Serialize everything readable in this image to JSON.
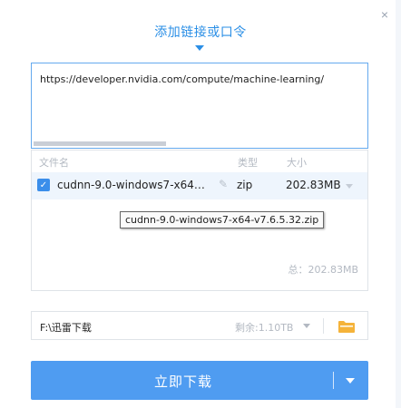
{
  "dialog": {
    "title": "添加链接或口令",
    "close_glyph": "×"
  },
  "url_input": {
    "value": "https://developer.nvidia.com/compute/machine-learning/"
  },
  "file_list": {
    "columns": {
      "name": "文件名",
      "type": "类型",
      "size": "大小"
    },
    "rows": [
      {
        "checked": true,
        "name": "cudnn-9.0-windows7-x64…",
        "type": "zip",
        "size": "202.83MB"
      }
    ],
    "tooltip": "cudnn-9.0-windows7-x64-v7.6.5.32.zip",
    "total": "总：202.83MB"
  },
  "save_location": {
    "path": "F:\\迅雷下载",
    "free_space": "剩余:1.10TB"
  },
  "download_button": {
    "label": "立即下载"
  },
  "colors": {
    "accent": "#2b8fe6",
    "button": "#4f9cf1",
    "folder": "#f5b33a"
  }
}
